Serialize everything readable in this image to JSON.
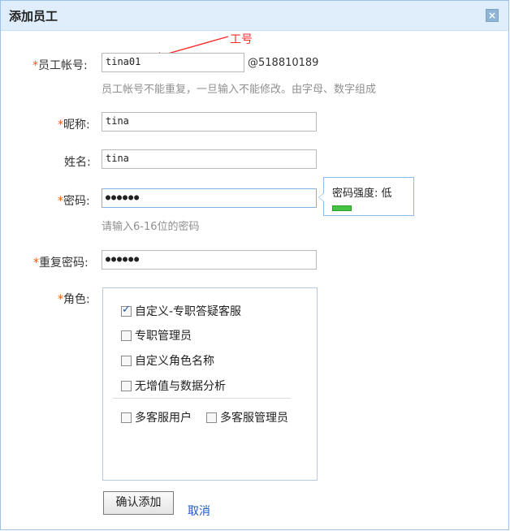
{
  "dialog": {
    "title": "添加员工",
    "close_icon": "close-icon"
  },
  "annotation": {
    "label": "工号"
  },
  "form": {
    "account": {
      "star": "*",
      "label": "员工帐号:",
      "value": "tina01",
      "suffix": "@518810189",
      "hint": "员工帐号不能重复，一旦输入不能修改。由字母、数字组成"
    },
    "nickname": {
      "star": "*",
      "label": "昵称:",
      "value": "tina"
    },
    "name": {
      "label": "姓名:",
      "value": "tina"
    },
    "password": {
      "star": "*",
      "label": "密码:",
      "value": "●●●●●●",
      "hint": "请输入6-16位的密码",
      "strength_label": "密码强度: 低",
      "strength_color": "#44c542"
    },
    "repeat_password": {
      "star": "*",
      "label": "重复密码:",
      "value": "●●●●●●"
    },
    "role": {
      "star": "*",
      "label": "角色:",
      "options": [
        {
          "label": "自定义-专职答疑客服",
          "checked": true
        },
        {
          "label": "专职管理员",
          "checked": false
        },
        {
          "label": "自定义角色名称",
          "checked": false
        },
        {
          "label": "无增值与数据分析",
          "checked": false
        }
      ],
      "extra_options": [
        {
          "label": "多客服用户",
          "checked": false
        },
        {
          "label": "多客服管理员",
          "checked": false
        }
      ]
    }
  },
  "actions": {
    "confirm": "确认添加",
    "cancel": "取消"
  },
  "colors": {
    "accent": "#1f58c4",
    "required": "#e85d0c",
    "annotation": "#ff2b2b",
    "titlebar": "#dfeefa"
  }
}
